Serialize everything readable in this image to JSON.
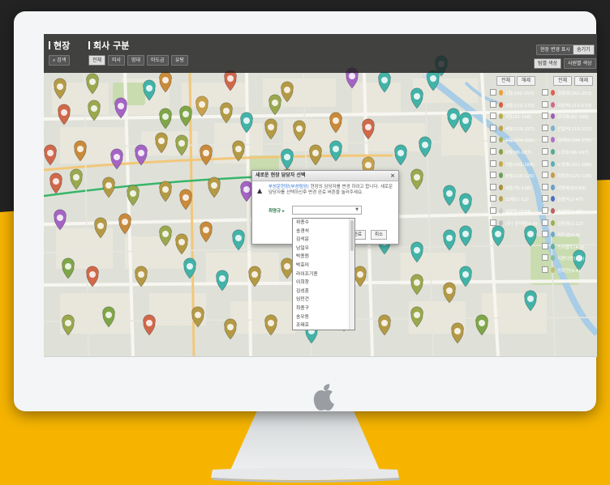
{
  "topbar": {
    "title_site": "현장",
    "title_company": "회사 구분",
    "search_label": "검색",
    "filters": [
      "전체",
      "미사",
      "멍대",
      "마도금",
      "유탕"
    ],
    "right_btn_1": "현장 변경 표시",
    "right_btn_2": "숨기기",
    "right_btn_3": "팀별 색상",
    "right_btn_4": "사원별 색상"
  },
  "panel": {
    "all_btn": "전체",
    "clear_btn": "해제",
    "left_items": [
      {
        "label": "1팀(161-253)",
        "color": "#e8a23a"
      },
      {
        "label": "2팀(112-173)",
        "color": "#d9603a"
      },
      {
        "label": "3팀(32-168)",
        "color": "#b8ae4a"
      },
      {
        "label": "4팀(119-157)",
        "color": "#c2a246"
      },
      {
        "label": "5팀(104-155)",
        "color": "#a9b152"
      },
      {
        "label": "6팀(96-167)",
        "color": "#88a044"
      },
      {
        "label": "7팀(101-166)",
        "color": "#c7a94c"
      },
      {
        "label": "8팀(120-126)",
        "color": "#6aa15a"
      },
      {
        "label": "9팀(75-118)",
        "color": "#a88d3f"
      },
      {
        "label": "10팀(1-12)",
        "color": "#b9a24a"
      },
      {
        "label": "설무팀 (624)",
        "color": "#cfcfcf"
      },
      {
        "label": "(주) 공직팀(0-4)",
        "color": "#bbbbbb"
      }
    ],
    "right_items": [
      {
        "label": "김행표(161-253)",
        "color": "#e06050"
      },
      {
        "label": "이승욱(112-173)",
        "color": "#d06a8a"
      },
      {
        "label": "강대호(82-168)",
        "color": "#9d5fb5"
      },
      {
        "label": "신일석(119-157)",
        "color": "#7fb0d0"
      },
      {
        "label": "김대성(104-155)",
        "color": "#b070c8"
      },
      {
        "label": "노정호(96-167)",
        "color": "#54a89a"
      },
      {
        "label": "노명호(101-166)",
        "color": "#58b0b8"
      },
      {
        "label": "최정호(120-126)",
        "color": "#c89a4a"
      },
      {
        "label": "이영복(63-89)",
        "color": "#6aa0c8"
      },
      {
        "label": "김종식(1-47)",
        "color": "#4a70c0"
      },
      {
        "label": "송영석(1-47)",
        "color": "#c06060"
      },
      {
        "label": "김진영(1-12)",
        "color": "#9fb050"
      },
      {
        "label": "허도섭(0-4)",
        "color": "#70a8c8"
      },
      {
        "label": "스위블트(4-2)",
        "color": "#60b0a0"
      },
      {
        "label": "지용다반(2-4)",
        "color": "#88c0a0"
      },
      {
        "label": "정화연(0-4)",
        "color": "#c0c070"
      }
    ]
  },
  "dialog": {
    "title": "새로운 현장 담당자 선택",
    "close": "×",
    "message_highlight": "부성운현장(부성팀당)",
    "message": " 현장의 담당자를 변경 하려고 합니다. 새로운 담당자를 선택하신후 변경 완료 버튼을 눌러주세요.",
    "select_label": "최명규",
    "ok_label": "완료",
    "cancel_label": "취소"
  },
  "dropdown_items": [
    "위종수",
    "송경석",
    "김석윤",
    "남일우",
    "박종원",
    "박효미",
    "라이프기종",
    "이희창",
    "김성훈",
    "임민건",
    "최종구",
    "송우동",
    "조태호"
  ]
}
